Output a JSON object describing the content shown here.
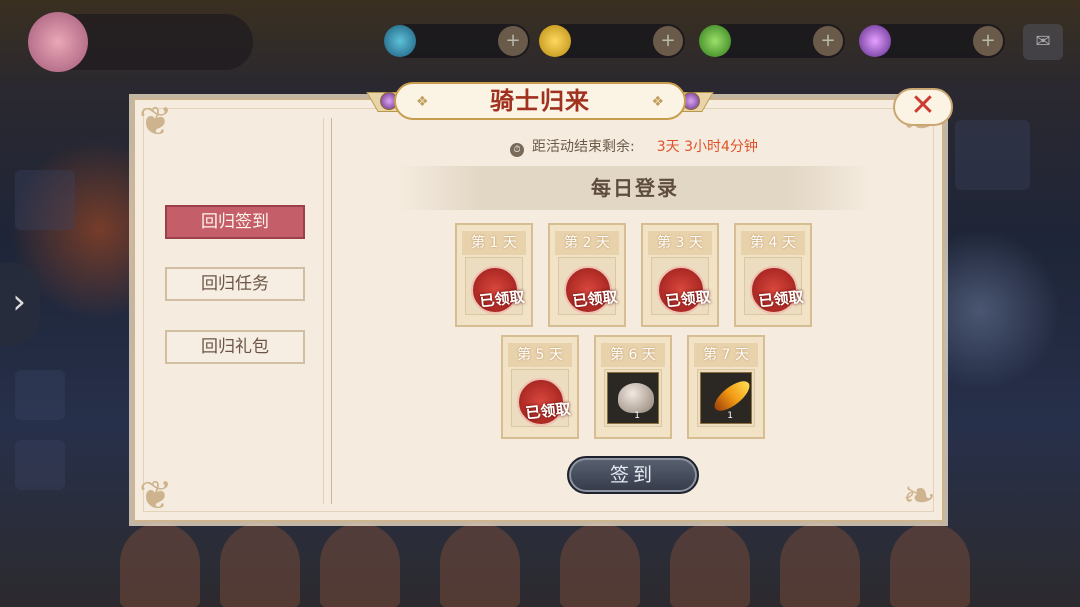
{
  "event": {
    "title": "骑士归来",
    "timer_label": "距活动结束剩余:",
    "timer_value": "3天 3小时4分钟"
  },
  "tabs": [
    {
      "label": "回归签到",
      "active": true
    },
    {
      "label": "回归任务",
      "active": false
    },
    {
      "label": "回归礼包",
      "active": false
    }
  ],
  "daily": {
    "section_title": "每日登录",
    "claimed_label": "已领取",
    "days": [
      {
        "label": "第 1 天",
        "state": "claimed"
      },
      {
        "label": "第 2 天",
        "state": "claimed"
      },
      {
        "label": "第 3 天",
        "state": "claimed"
      },
      {
        "label": "第 4 天",
        "state": "claimed"
      },
      {
        "label": "第 5 天",
        "state": "claimed"
      },
      {
        "label": "第 6 天",
        "state": "reward",
        "item_icon": "ore-rock-icon",
        "count": "1"
      },
      {
        "label": "第 7 天",
        "state": "reward",
        "item_icon": "golden-feather-icon",
        "count": "1"
      }
    ],
    "signin_label": "签到"
  },
  "icons": {
    "close": "close-icon",
    "timer": "stopwatch-icon"
  },
  "colors": {
    "accent_red": "#c45e68",
    "timer_orange": "#e0532a",
    "title_red": "#a0311f"
  }
}
